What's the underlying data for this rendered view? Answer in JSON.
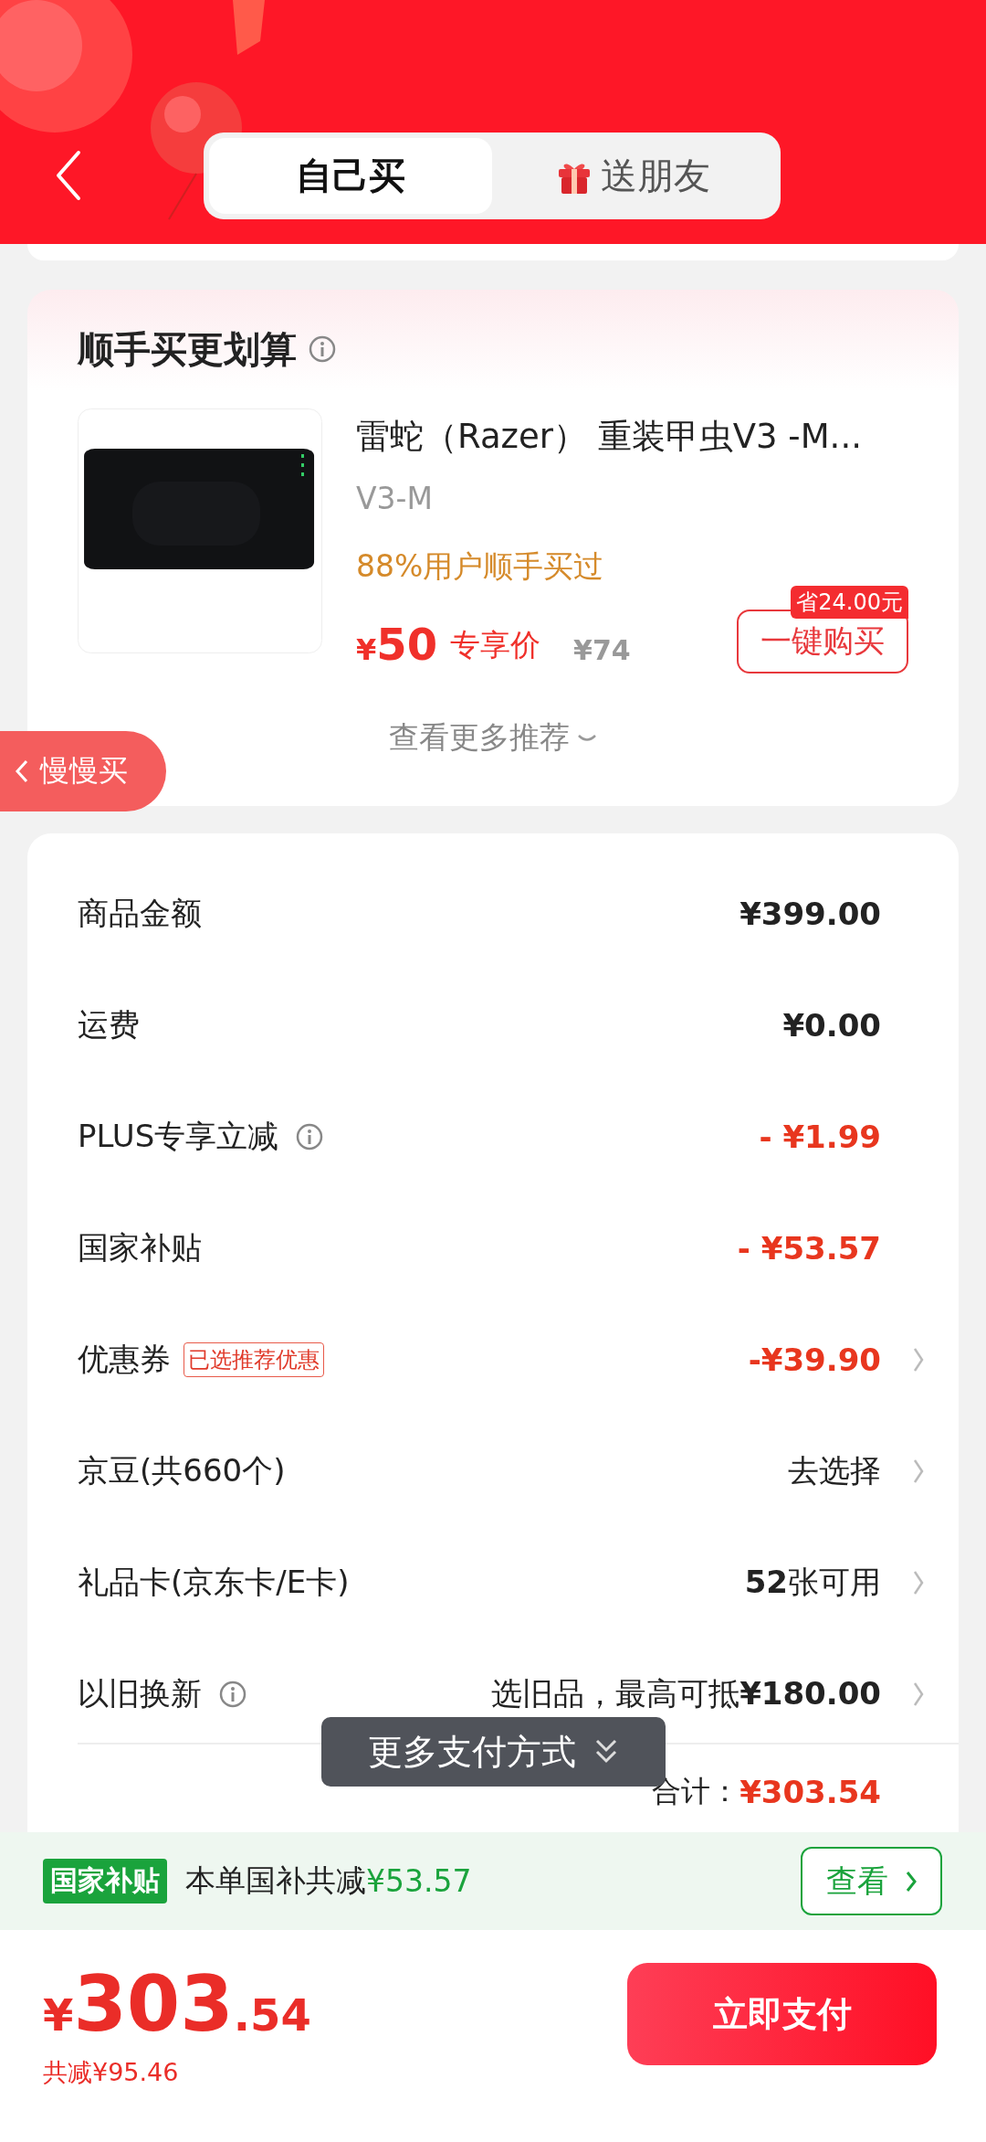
{
  "header": {
    "tabs": [
      {
        "label": "自己买",
        "selected": true,
        "kind": "plain"
      },
      {
        "label": "送朋友",
        "selected": false,
        "kind": "gift"
      }
    ]
  },
  "recommend": {
    "title": "顺手买更划算",
    "product": {
      "title": "雷蛇（Razer） 重装甲虫V3 -M...",
      "variant": "V3-M",
      "note": "88%用户顺手买过",
      "currency": "¥",
      "price": "50",
      "price_label": "专享价",
      "original_price": "¥74",
      "saving": "省24.00元",
      "buy_button": "一键购买"
    },
    "more": "查看更多推荐"
  },
  "side_button": "慢慢买",
  "summary": {
    "rows": [
      {
        "label": "商品金额",
        "info": false,
        "kind": "plain",
        "value": "**¥399.00**",
        "chevron": false
      },
      {
        "label": "运费",
        "info": false,
        "kind": "plain",
        "value": "**¥0.00**",
        "chevron": false
      },
      {
        "label": "PLUS专享立减",
        "info": true,
        "kind": "discount",
        "value": "- ¥1.99",
        "chevron": false
      },
      {
        "label": "国家补贴",
        "info": false,
        "kind": "discount",
        "value": "- ¥53.57",
        "chevron": false
      },
      {
        "label": "优惠券",
        "info": false,
        "tag": "已选推荐优惠",
        "kind": "discount",
        "value": "-¥39.90",
        "chevron": true
      },
      {
        "label": "京豆(共660个)",
        "info": false,
        "kind": "plain",
        "value": "去选择",
        "chevron": true
      },
      {
        "label": "礼品卡(京东卡/E卡)",
        "info": false,
        "kind": "plain",
        "value": "**52**张可用",
        "chevron": true
      },
      {
        "label": "以旧换新",
        "info": true,
        "kind": "plain",
        "value": "选旧品，最高可抵**¥180.00**",
        "chevron": true
      }
    ],
    "total_label": "合计：",
    "total": "¥303.54"
  },
  "toast": "更多支付方式",
  "subsidy_bar": {
    "badge": "国家补贴",
    "text": "本单国补共减",
    "amount": "¥53.57",
    "button": "查看"
  },
  "footer": {
    "currency": "¥",
    "price_int": "303",
    "price_dec": ".54",
    "saved": "共减¥95.46",
    "pay_button": "立即支付"
  }
}
